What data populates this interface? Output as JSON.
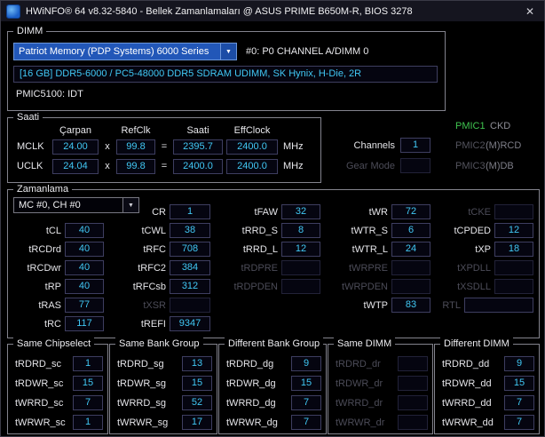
{
  "colors": {
    "accent": "#41c8f5",
    "pmic_green": "#3fc44f",
    "combo_blue": "#2257b8",
    "dim": "#4c4c58"
  },
  "icons": {
    "chevron_down": "▼",
    "close": "✕"
  },
  "titlebar": {
    "title": "HWiNFO® 64 v8.32-5840 - Bellek Zamanlamaları @ ASUS PRIME B650M-R, BIOS 3278"
  },
  "dimm": {
    "group_label": "DIMM",
    "module_select": "Patriot Memory (PDP Systems) 6000 Series",
    "slot_label": "#0: P0 CHANNEL A/DIMM 0",
    "module_details": "[16 GB] DDR5-6000 / PC5-48000 DDR5 SDRAM UDIMM, SK Hynix, H-Die, 2R",
    "pmic_info": "PMIC5100: IDT"
  },
  "clocks": {
    "group_label": "Saati",
    "headers": {
      "mult": "Çarpan",
      "refclk": "RefClk",
      "clock": "Saati",
      "effclock": "EffClock"
    },
    "rows": [
      {
        "name": "MCLK",
        "mult": "24.00",
        "times": "x",
        "refclk": "99.8",
        "equals": "=",
        "clock": "2395.7",
        "effclock": "2400.0",
        "unit": "MHz"
      },
      {
        "name": "UCLK",
        "mult": "24.04",
        "times": "x",
        "refclk": "99.8",
        "equals": "=",
        "clock": "2400.0",
        "effclock": "2400.0",
        "unit": "MHz"
      }
    ]
  },
  "status": {
    "pmic1_label": "PMIC1",
    "pmic1_value": "CKD",
    "channels_label": "Channels",
    "channels_value": "1",
    "pmic2_label": "PMIC2",
    "pmic2_value": "(M)RCD",
    "gear_label": "Gear Mode",
    "gear_value": "",
    "pmic3_label": "PMIC3",
    "pmic3_value": "(M)DB"
  },
  "timings": {
    "group_label": "Zamanlama",
    "channel_select": "MC #0, CH #0",
    "cells": {
      "cr": {
        "label": "CR",
        "value": "1"
      },
      "tfaw": {
        "label": "tFAW",
        "value": "32"
      },
      "twr": {
        "label": "tWR",
        "value": "72"
      },
      "tcke": {
        "label": "tCKE",
        "value": ""
      },
      "tcl": {
        "label": "tCL",
        "value": "40"
      },
      "tcwl": {
        "label": "tCWL",
        "value": "38"
      },
      "trrd_s": {
        "label": "tRRD_S",
        "value": "8"
      },
      "twtr_s": {
        "label": "tWTR_S",
        "value": "6"
      },
      "tcpded": {
        "label": "tCPDED",
        "value": "12"
      },
      "trcdrd": {
        "label": "tRCDrd",
        "value": "40"
      },
      "trfc": {
        "label": "tRFC",
        "value": "708"
      },
      "trrd_l": {
        "label": "tRRD_L",
        "value": "12"
      },
      "twtr_l": {
        "label": "tWTR_L",
        "value": "24"
      },
      "txp": {
        "label": "tXP",
        "value": "18"
      },
      "trcdwr": {
        "label": "tRCDwr",
        "value": "40"
      },
      "trfc2": {
        "label": "tRFC2",
        "value": "384"
      },
      "trdpre": {
        "label": "tRDPRE",
        "value": ""
      },
      "twrpre": {
        "label": "tWRPRE",
        "value": ""
      },
      "txpdll": {
        "label": "tXPDLL",
        "value": ""
      },
      "trp": {
        "label": "tRP",
        "value": "40"
      },
      "trfcsb": {
        "label": "tRFCsb",
        "value": "312"
      },
      "trdpden": {
        "label": "tRDPDEN",
        "value": ""
      },
      "twrpden": {
        "label": "tWRPDEN",
        "value": ""
      },
      "txsdll": {
        "label": "tXSDLL",
        "value": ""
      },
      "tras": {
        "label": "tRAS",
        "value": "77"
      },
      "txsr": {
        "label": "tXSR",
        "value": ""
      },
      "twtp": {
        "label": "tWTP",
        "value": "83"
      },
      "rtl": {
        "label": "RTL",
        "value": ""
      },
      "trc": {
        "label": "tRC",
        "value": "117"
      },
      "trefi": {
        "label": "tREFI",
        "value": "9347"
      }
    }
  },
  "turnarounds": {
    "groups": [
      {
        "title": "Same Chipselect",
        "rows": [
          {
            "label": "tRDRD_sc",
            "value": "1"
          },
          {
            "label": "tRDWR_sc",
            "value": "15"
          },
          {
            "label": "tWRRD_sc",
            "value": "7"
          },
          {
            "label": "tWRWR_sc",
            "value": "1"
          }
        ]
      },
      {
        "title": "Same Bank Group",
        "rows": [
          {
            "label": "tRDRD_sg",
            "value": "13"
          },
          {
            "label": "tRDWR_sg",
            "value": "15"
          },
          {
            "label": "tWRRD_sg",
            "value": "52"
          },
          {
            "label": "tWRWR_sg",
            "value": "17"
          }
        ]
      },
      {
        "title": "Different Bank Group",
        "rows": [
          {
            "label": "tRDRD_dg",
            "value": "9"
          },
          {
            "label": "tRDWR_dg",
            "value": "15"
          },
          {
            "label": "tWRRD_dg",
            "value": "7"
          },
          {
            "label": "tWRWR_dg",
            "value": "7"
          }
        ]
      },
      {
        "title": "Same DIMM",
        "rows": [
          {
            "label": "tRDRD_dr",
            "value": ""
          },
          {
            "label": "tRDWR_dr",
            "value": ""
          },
          {
            "label": "tWRRD_dr",
            "value": ""
          },
          {
            "label": "tWRWR_dr",
            "value": ""
          }
        ]
      },
      {
        "title": "Different DIMM",
        "rows": [
          {
            "label": "tRDRD_dd",
            "value": "9"
          },
          {
            "label": "tRDWR_dd",
            "value": "15"
          },
          {
            "label": "tWRRD_dd",
            "value": "7"
          },
          {
            "label": "tWRWR_dd",
            "value": "7"
          }
        ]
      }
    ]
  }
}
